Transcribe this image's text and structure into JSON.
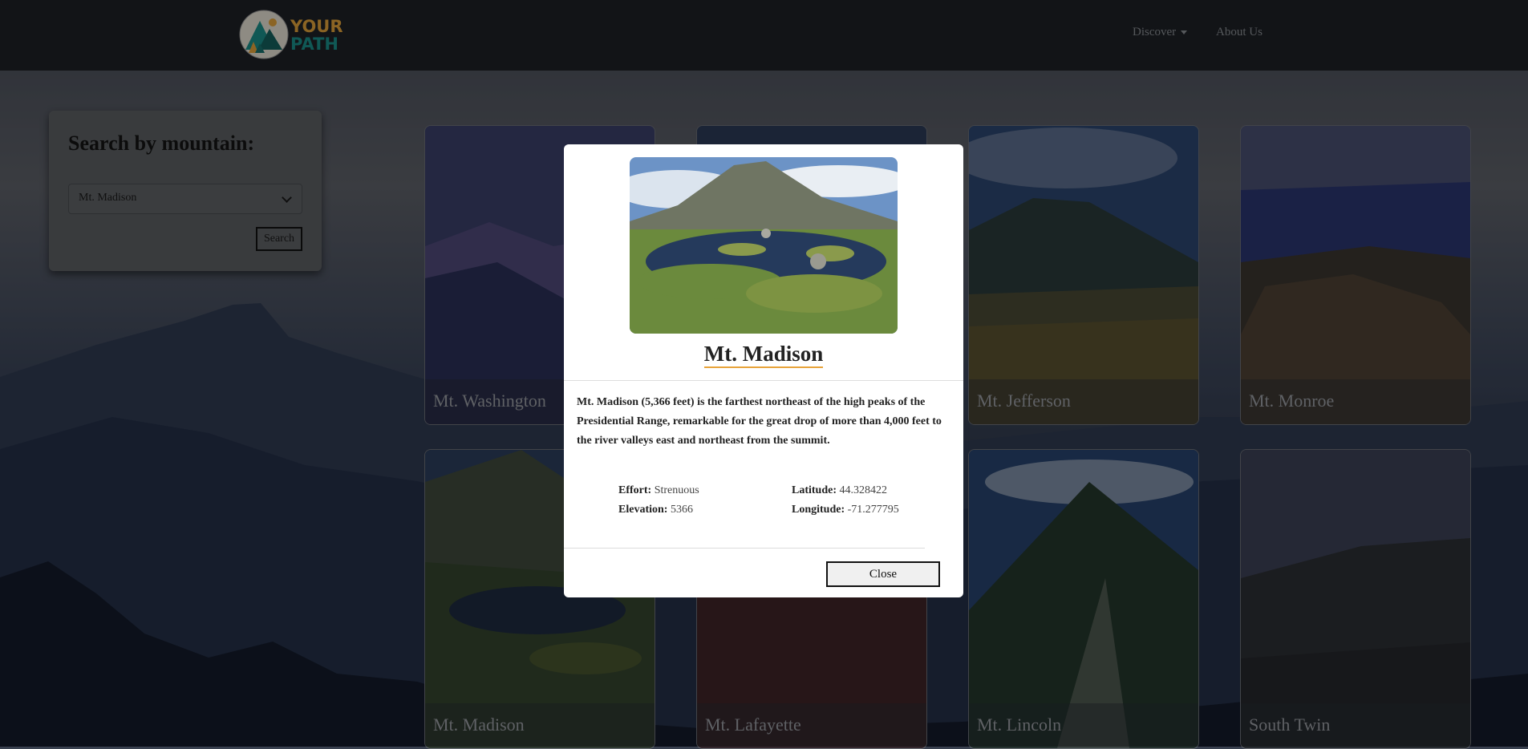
{
  "navbar": {
    "logo_line1": "YOUR",
    "logo_line2": "PATH",
    "discover_label": "Discover",
    "about_label": "About Us"
  },
  "search": {
    "title": "Search by mountain:",
    "selected_value": "Mt. Madison",
    "button_label": "Search"
  },
  "cards": [
    {
      "name": "Mt. Washington"
    },
    {
      "name": ""
    },
    {
      "name": "Mt. Jefferson"
    },
    {
      "name": "Mt. Monroe"
    },
    {
      "name": "Mt. Madison"
    },
    {
      "name": "Mt. Lafayette"
    },
    {
      "name": "Mt. Lincoln"
    },
    {
      "name": "South Twin"
    }
  ],
  "modal": {
    "title": "Mt. Madison",
    "description": "Mt. Madison (5,366 feet) is the farthest northeast of the high peaks of the Presidential Range, remarkable for the great drop of more than 4,000 feet to the river valleys east and northeast from the summit.",
    "effort_label": "Effort:",
    "effort_value": "Strenuous",
    "elevation_label": "Elevation:",
    "elevation_value": "5366",
    "latitude_label": "Latitude:",
    "latitude_value": "44.328422",
    "longitude_label": "Longitude:",
    "longitude_value": "-71.277795",
    "close_label": "Close"
  },
  "colors": {
    "accent_underline": "#e8a33a",
    "navbar_bg": "#1e2126",
    "logo_orange": "#e0a23a",
    "logo_teal": "#1b8e8a"
  }
}
